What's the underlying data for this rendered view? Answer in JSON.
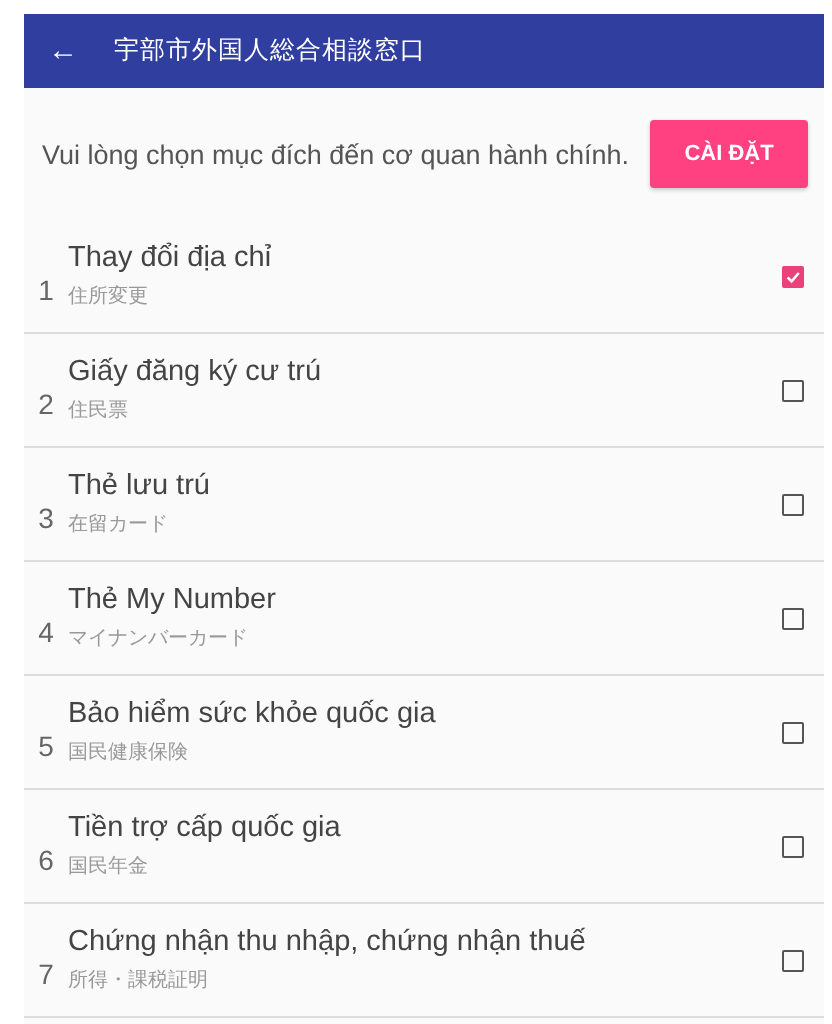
{
  "app_bar": {
    "back_icon": "←",
    "title": "宇部市外国人総合相談窓口"
  },
  "prompt": {
    "text": "Vui lòng chọn mục đích đến cơ quan hành chính.",
    "button": "CÀI ĐẶT"
  },
  "items": [
    {
      "number": "1",
      "title": "Thay đổi địa chỉ",
      "subtitle": "住所変更",
      "checked": true
    },
    {
      "number": "2",
      "title": "Giấy đăng ký cư trú",
      "subtitle": "住民票",
      "checked": false
    },
    {
      "number": "3",
      "title": "Thẻ lưu trú",
      "subtitle": "在留カード",
      "checked": false
    },
    {
      "number": "4",
      "title": "Thẻ My Number",
      "subtitle": "マイナンバーカード",
      "checked": false
    },
    {
      "number": "5",
      "title": "Bảo hiểm sức khỏe quốc gia",
      "subtitle": "国民健康保険",
      "checked": false
    },
    {
      "number": "6",
      "title": "Tiền trợ cấp quốc gia",
      "subtitle": "国民年金",
      "checked": false
    },
    {
      "number": "7",
      "title": "Chứng nhận thu nhập, chứng nhận thuế",
      "subtitle": "所得・課税証明",
      "checked": false
    }
  ]
}
